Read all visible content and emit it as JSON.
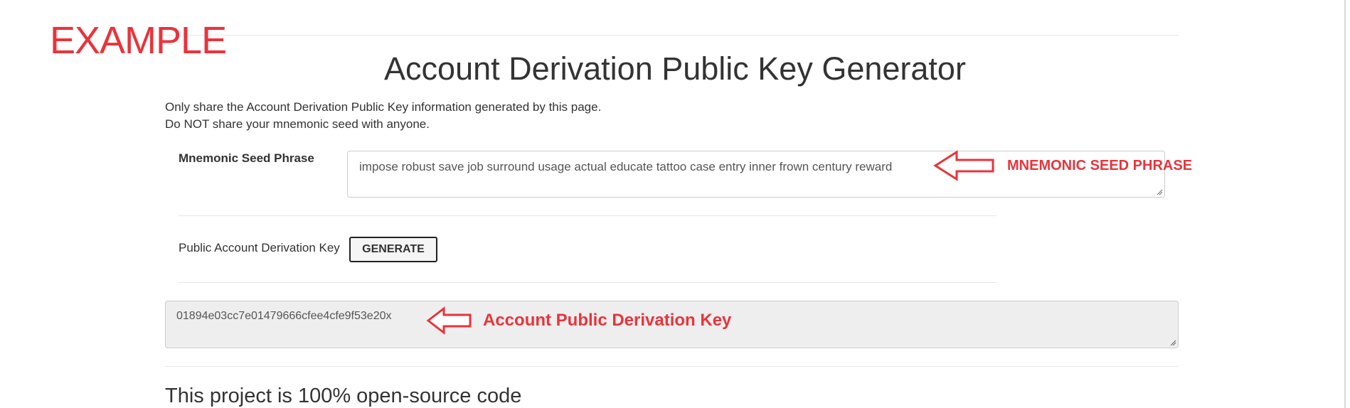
{
  "overlay": {
    "example_label": "EXAMPLE",
    "annotations": {
      "seed": "MNEMONIC SEED PHRASE",
      "key": "Account Public Derivation Key"
    },
    "annotation_color": "#e8343c"
  },
  "header": {
    "title": "Account Derivation Public Key Generator"
  },
  "intro": {
    "line1": "Only share the Account Derivation Public Key information generated by this page.",
    "line2": "Do NOT share your mnemonic seed with anyone."
  },
  "seed": {
    "label": "Mnemonic Seed Phrase",
    "value": "impose robust save job surround usage actual educate tattoo case entry inner frown century reward"
  },
  "public_key": {
    "label": "Public Account Derivation Key",
    "generate_label": "GENERATE",
    "value": "01894e03cc7e01479666cfee4cfe9f53e20x"
  },
  "footer": {
    "heading": "This project is 100% open-source code"
  }
}
